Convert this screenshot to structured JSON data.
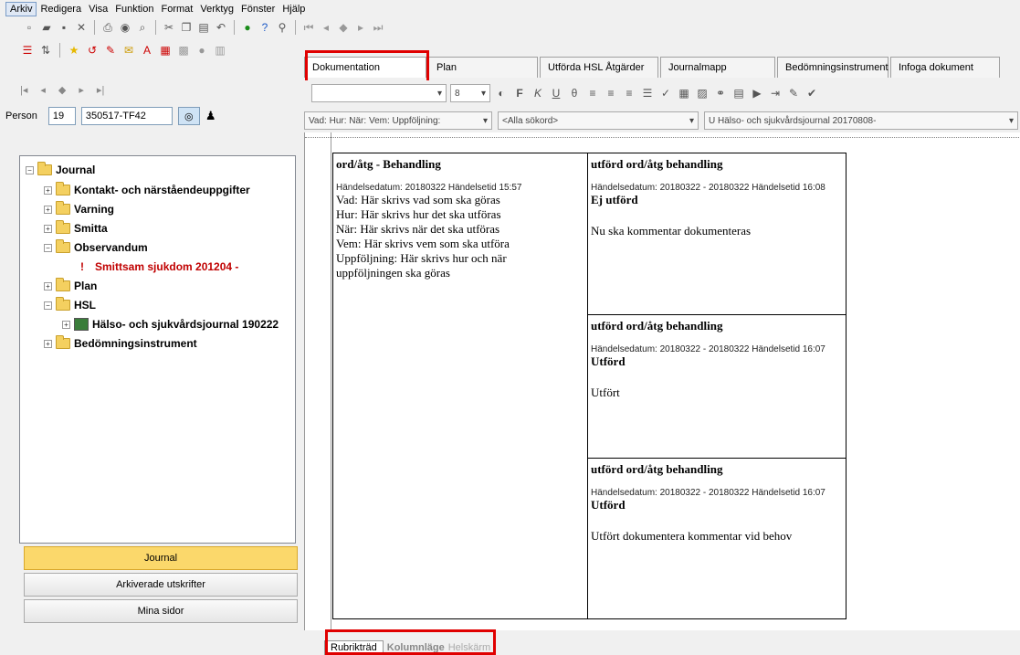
{
  "menubar": [
    "Arkiv",
    "Redigera",
    "Visa",
    "Funktion",
    "Format",
    "Verktyg",
    "Fönster",
    "Hjälp"
  ],
  "person": {
    "label": "Person",
    "number": "19",
    "id": "350517-TF42"
  },
  "tree": {
    "root": "Journal",
    "items": [
      {
        "label": "Kontakt- och närståendeuppgifter",
        "expander": "+"
      },
      {
        "label": "Varning",
        "expander": "+"
      },
      {
        "label": "Smitta",
        "expander": "+"
      },
      {
        "label": "Observandum",
        "expander": "−"
      },
      {
        "label": "Smittsam sjukdom 201204 -",
        "color": "#c00000"
      },
      {
        "label": "Plan",
        "expander": "+"
      },
      {
        "label": "HSL",
        "expander": "−"
      },
      {
        "label": "Hälso- och sjukvårdsjournal 190222",
        "expander": "+"
      },
      {
        "label": "Bedömningsinstrument",
        "expander": "+"
      }
    ]
  },
  "nav_buttons": [
    "Journal",
    "Arkiverade utskrifter",
    "Mina sidor"
  ],
  "tabs": [
    "Dokumentation",
    "Plan",
    "Utförda HSL Åtgärder",
    "Journalmapp",
    "Bedömningsinstrument",
    "Infoga dokument"
  ],
  "fmt": {
    "font_size": "8"
  },
  "filters": {
    "f1": "Vad: Hur: När: Vem: Uppföljning:",
    "f2": "<Alla sökord>",
    "f3": "U Hälso- och sjukvårdsjournal 20170808-"
  },
  "cards": {
    "main": {
      "title": "ord/åtg - Behandling",
      "meta": "Händelsedatum: 20180322 Händelsetid 15:57",
      "lines": [
        "Vad: Här skrivs vad som ska göras",
        "Hur: Här skrivs hur det ska utföras",
        "När: Här skrivs när det ska utföras",
        "Vem: Här skrivs vem som ska utföra",
        "Uppföljning: Här skrivs hur och när",
        "uppföljningen ska göras"
      ]
    },
    "r1": {
      "title": "utförd ord/åtg behandling",
      "meta": "Händelsedatum: 20180322 - 20180322 Händelsetid 16:08",
      "status": "Ej utförd",
      "comment": "Nu ska kommentar dokumenteras"
    },
    "r2": {
      "title": "utförd ord/åtg behandling",
      "meta": "Händelsedatum: 20180322 - 20180322 Händelsetid 16:07",
      "status": "Utförd",
      "comment": "Utfört"
    },
    "r3": {
      "title": "utförd ord/åtg behandling",
      "meta": "Händelsedatum: 20180322 - 20180322 Händelsetid 16:07",
      "status": "Utförd",
      "comment": "Utfört dokumentera kommentar vid behov"
    }
  },
  "bottom_tabs": [
    "Rubrikträd",
    "Kolumnläge",
    "Helskärm"
  ],
  "colors": {
    "accent_red": "#e00000",
    "nav_active": "#fbd86b",
    "alert_text": "#c00000"
  }
}
